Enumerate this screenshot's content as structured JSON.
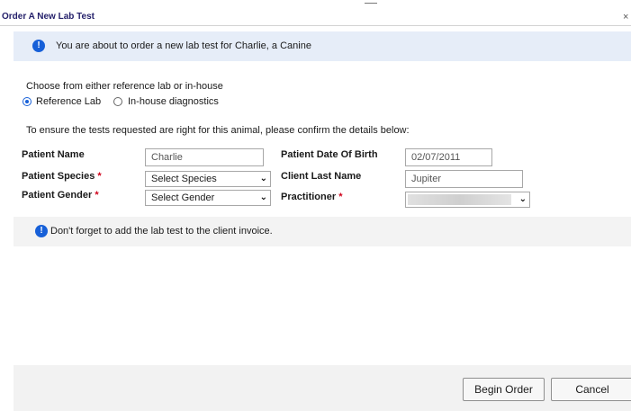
{
  "dialog": {
    "title": "Order A New Lab Test",
    "close_glyph": "×"
  },
  "info_banner": {
    "icon": "info-icon",
    "icon_glyph": "!",
    "text": "You are about to order a new lab test for Charlie, a Canine"
  },
  "lab_choice": {
    "prompt": "Choose from either reference lab or in-house",
    "options": [
      {
        "label": "Reference Lab",
        "selected": true
      },
      {
        "label": "In-house diagnostics",
        "selected": false
      }
    ]
  },
  "instruction": "To ensure the tests requested are right for this animal, please confirm the details below:",
  "form": {
    "patient_name": {
      "label": "Patient Name",
      "value": "Charlie"
    },
    "patient_species": {
      "label": "Patient Species",
      "required_mark": "*",
      "selected": "Select Species"
    },
    "patient_gender": {
      "label": "Patient Gender",
      "required_mark": "*",
      "selected": "Select Gender"
    },
    "patient_dob": {
      "label": "Patient Date Of Birth",
      "value": "02/07/2011"
    },
    "client_last_name": {
      "label": "Client Last Name",
      "value": "Jupiter"
    },
    "practitioner": {
      "label": "Practitioner",
      "required_mark": "*",
      "selected": ""
    }
  },
  "reminder": {
    "icon": "info-icon",
    "icon_glyph": "!",
    "text": "Don't forget to add the lab test to the client invoice."
  },
  "footer": {
    "begin_order_label": "Begin Order",
    "cancel_label": "Cancel"
  },
  "colors": {
    "accent": "#1760d8",
    "title": "#25216b",
    "required": "#d0021b",
    "info_banner_bg": "#e6edf8",
    "reminder_bg": "#f3f3f3",
    "footer_bg": "#f2f2f2"
  }
}
